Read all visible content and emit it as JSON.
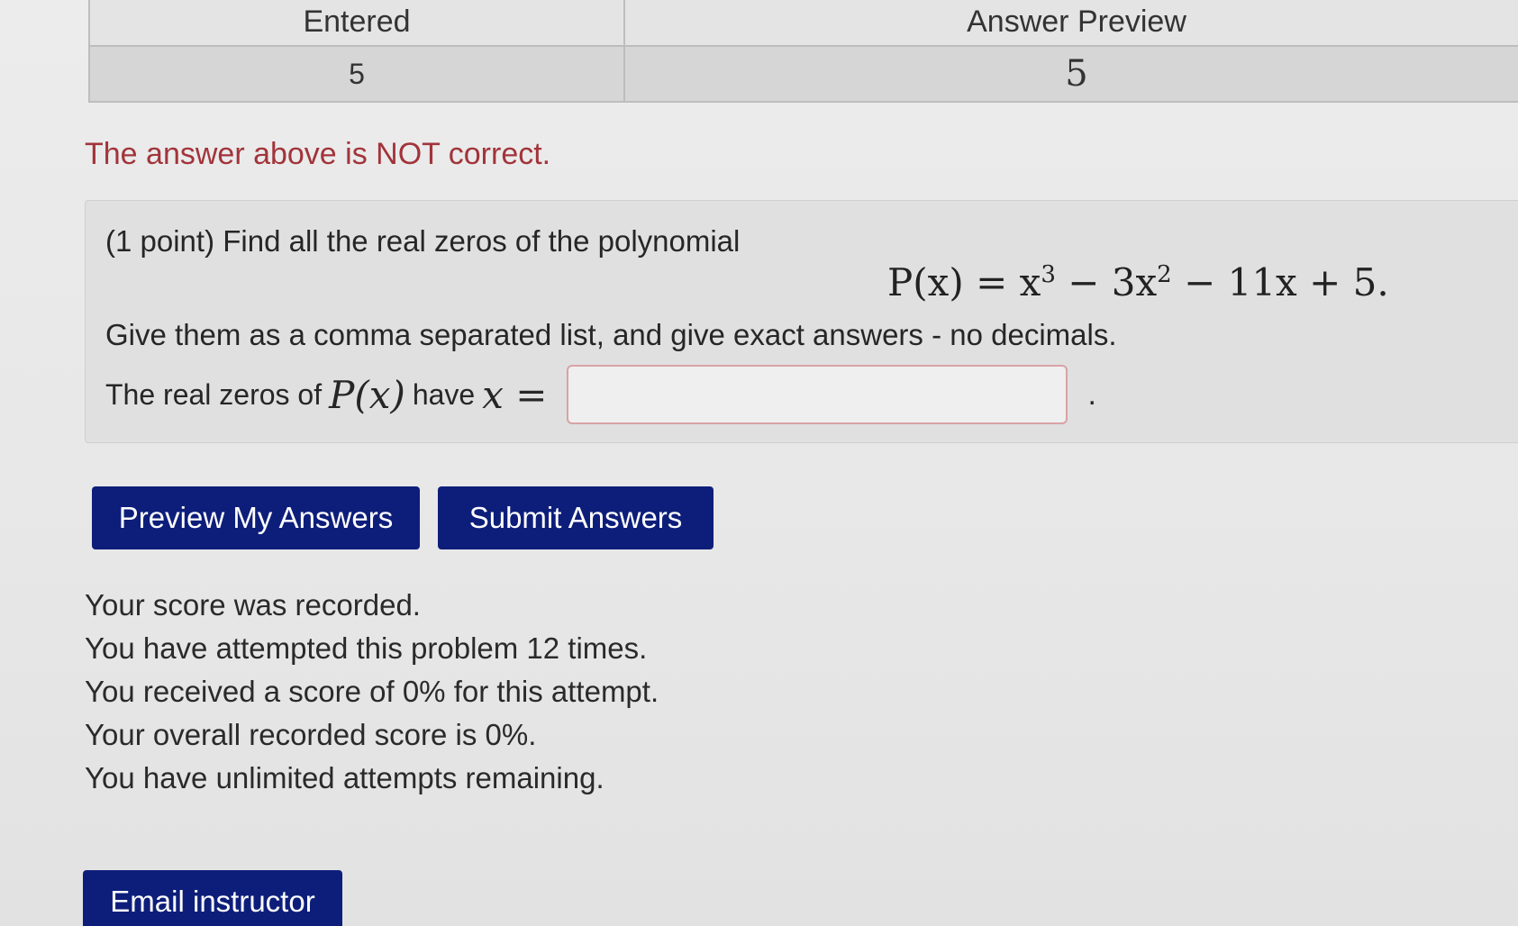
{
  "results_table": {
    "headers": [
      "Entered",
      "Answer Preview"
    ],
    "entered_value": "5",
    "preview_value": "5"
  },
  "feedback": {
    "message": "The answer above is NOT correct."
  },
  "problem": {
    "intro": "(1 point) Find all the real zeros of the polynomial",
    "equation": {
      "lhs": "P(x)",
      "parts": [
        "x",
        "3",
        " − 3x",
        "2",
        " − 11x + 5."
      ]
    },
    "instructions": "Give them as a comma separated list, and give exact answers - no decimals.",
    "answer_prefix": "The real zeros of",
    "answer_math_1": "P(x)",
    "answer_mid": "have",
    "answer_math_2": "x =",
    "answer_value": "",
    "answer_suffix": "."
  },
  "buttons": {
    "preview": "Preview My Answers",
    "submit": "Submit Answers",
    "email": "Email instructor"
  },
  "status_lines": [
    "Your score was recorded.",
    "You have attempted this problem 12 times.",
    "You received a score of 0% for this attempt.",
    "Your overall recorded score is 0%.",
    "You have unlimited attempts remaining."
  ],
  "colors": {
    "button_bg": "#0d1e7a",
    "error_text": "#a2343b",
    "input_border": "#d9a2a6"
  }
}
